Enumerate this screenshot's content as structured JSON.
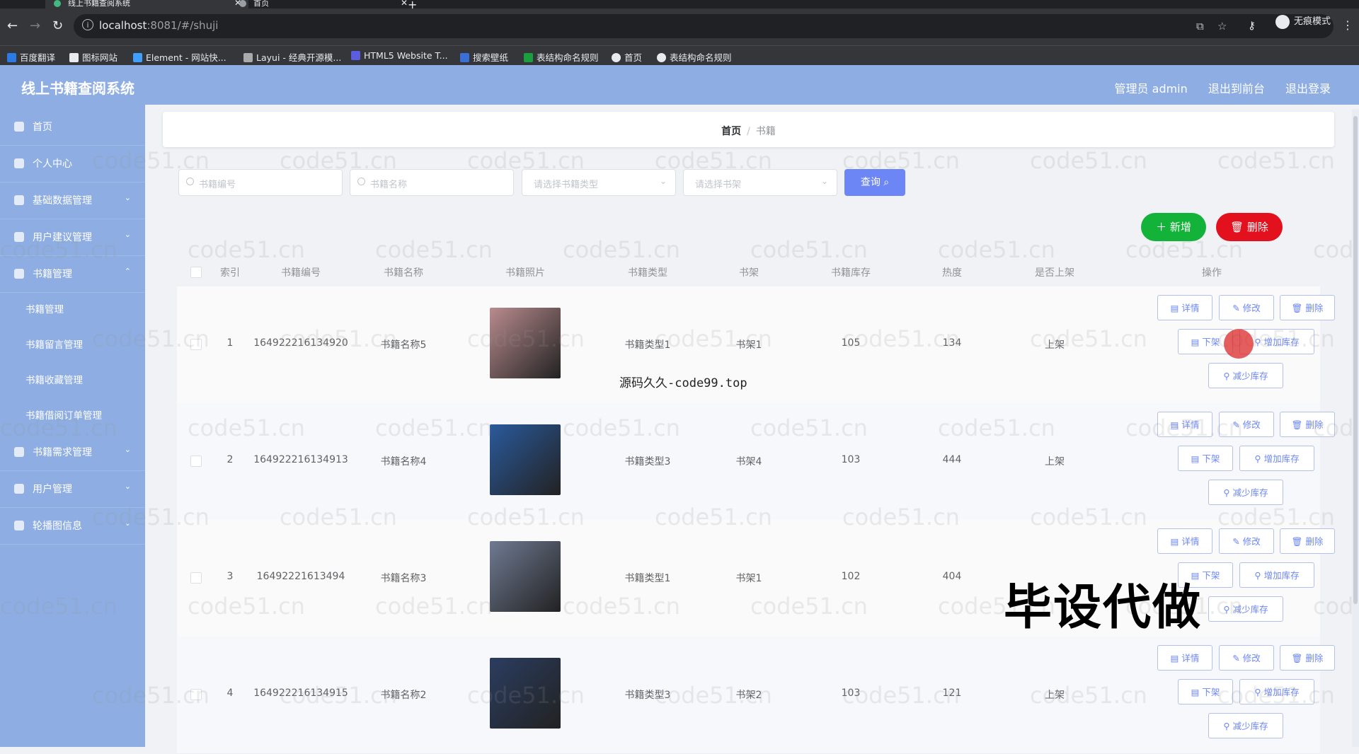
{
  "browser": {
    "tabs": [
      {
        "title": "线上书籍查阅系统",
        "active": true
      },
      {
        "title": "首页",
        "active": false
      }
    ],
    "url_host": "localhost",
    "url_rest": ":8081/#/shuji",
    "incognito_label": "无痕模式",
    "bookmarks": [
      "百度翻译",
      "图标网站",
      "Element - 网站快...",
      "Layui - 经典开源模...",
      "HTML5 Website T...",
      "搜索壁纸",
      "表结构命名规则",
      "首页",
      "表结构命名规则"
    ]
  },
  "header": {
    "title": "线上书籍查阅系统",
    "admin": "管理员 admin",
    "to_front": "退出到前台",
    "logout": "退出登录"
  },
  "sidebar": {
    "items": [
      {
        "label": "首页"
      },
      {
        "label": "个人中心"
      },
      {
        "label": "基础数据管理"
      },
      {
        "label": "用户建议管理"
      },
      {
        "label": "书籍管理"
      },
      {
        "label": "书籍管理"
      },
      {
        "label": "书籍留言管理"
      },
      {
        "label": "书籍收藏管理"
      },
      {
        "label": "书籍借阅订单管理"
      },
      {
        "label": "书籍需求管理"
      },
      {
        "label": "用户管理"
      },
      {
        "label": "轮播图信息"
      }
    ]
  },
  "breadcrumb": {
    "home": "首页",
    "current": "书籍"
  },
  "search": {
    "code_placeholder": "书籍编号",
    "name_placeholder": "书籍名称",
    "type_placeholder": "请选择书籍类型",
    "shelf_placeholder": "请选择书架",
    "query_label": "查询"
  },
  "actions": {
    "add": "新增",
    "delete": "删除"
  },
  "table": {
    "headers": [
      "索引",
      "书籍编号",
      "书籍名称",
      "书籍照片",
      "书籍类型",
      "书架",
      "书籍库存",
      "热度",
      "是否上架",
      "操作"
    ],
    "rows": [
      {
        "index": "1",
        "code": "164922216134920",
        "name": "书籍名称5",
        "type": "书籍类型1",
        "shelf": "书架1",
        "stock": "105",
        "heat": "134",
        "status": "上架",
        "img_color": "#b98b8e"
      },
      {
        "index": "2",
        "code": "164922216134913",
        "name": "书籍名称4",
        "type": "书籍类型3",
        "shelf": "书架4",
        "stock": "103",
        "heat": "444",
        "status": "上架",
        "img_color": "#2a5a9c"
      },
      {
        "index": "3",
        "code": "16492221613494",
        "name": "书籍名称3",
        "type": "书籍类型1",
        "shelf": "书架1",
        "stock": "102",
        "heat": "404",
        "status": "",
        "img_color": "#6f7a92"
      },
      {
        "index": "4",
        "code": "164922216134915",
        "name": "书籍名称2",
        "type": "书籍类型3",
        "shelf": "书架2",
        "stock": "103",
        "heat": "121",
        "status": "上架",
        "img_color": "#2b3d60"
      }
    ],
    "ops": {
      "detail": "详情",
      "edit": "修改",
      "delete": "删除",
      "offshelf": "下架",
      "add_stock": "增加库存",
      "reduce_stock": "减少库存"
    }
  },
  "watermark": "code51.cn",
  "overlay_small": "源码久久-code99.top",
  "overlay_big": "毕设代做",
  "colors": {
    "accent": "#8eaee3",
    "primary": "#6c87f5",
    "success": "#13b339",
    "danger": "#e3101d"
  }
}
